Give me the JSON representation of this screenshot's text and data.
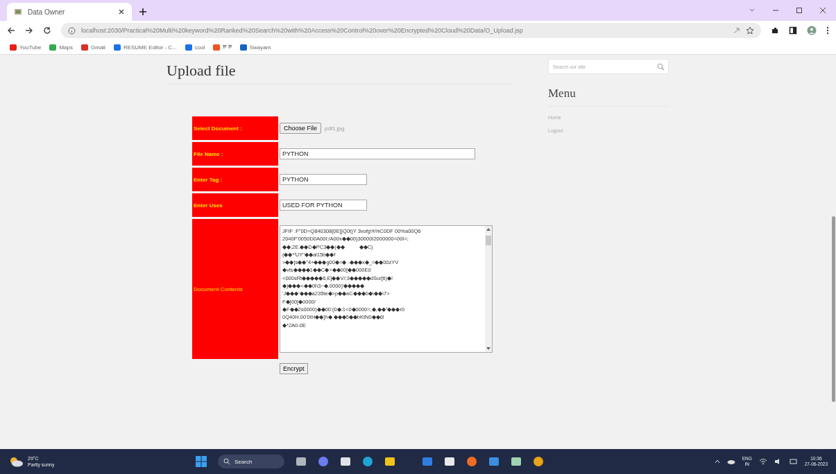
{
  "browser": {
    "tabs": [
      {
        "title": "Data Owner"
      }
    ],
    "url": "localhost:2030/Practical%20Multi%20keyword%20Ranked%20Search%20with%20Access%20Control%20over%20Encrypted%20Cloud%20Data/O_Upload.jsp",
    "bookmarks": [
      {
        "label": "YouTube",
        "color": "#e62117"
      },
      {
        "label": "Maps",
        "color": "#34a853"
      },
      {
        "label": "Gmail",
        "color": "#d93025"
      },
      {
        "label": "RESUME Editor - C...",
        "color": "#1a73e8"
      },
      {
        "label": "cool",
        "color": "#1a73e8"
      },
      {
        "label": "ਸ਼ ਸ਼",
        "color": "#f4511e"
      },
      {
        "label": "Swayam",
        "color": "#1565c0"
      }
    ]
  },
  "page": {
    "title": "Upload file",
    "form": {
      "rows": [
        {
          "kind": "file",
          "label": "Select Document :",
          "button": "Choose File",
          "value": "pdf1.jpg"
        },
        {
          "kind": "text",
          "label": "File Name :",
          "value": "PYTHON",
          "wide": true
        },
        {
          "kind": "text",
          "label": "Enter Tag :",
          "value": "PYTHON",
          "wide": false
        },
        {
          "kind": "text",
          "label": "Enter Uses",
          "value": "USED FOR PYTHON",
          "wide": false
        },
        {
          "kind": "textarea",
          "label": "Document Contents",
          "value": "JFIF :F\"0D=Q840308[0E]}Q0t}Y 3vofg%%C0DF 00%a00Q6\n2040F'0050D0A00I:/A00x◆◆00}30000I2000000=00I=;\n◆◆;2E.◆◆D◆PC3◆◆(◆◆          ◆◆C)\n(◆◆*'UY\"◆◆al15b◆◆f\n>◆◆]s◆◆\"4+◆◆◆g00◆=◆ -◆◆◆x◆_=◆◆00zYV\n◆vts◆◆◆◆1◆◆C◆=◆◆00[◆◆000E0\n<000sRt◆◆◆◆◆6,E]◆◆V/;3◆◆◆◆◆dSur[ti)◆!\n◆)◆◆◆<◆◆0h3~◆.0000)'◆◆◆◆◆\n'J◆◆◆'◆◆◆a235te◆>p◆◆aC◆◆◆0◆\\◆◆\\7>\nF◆]00[◆0000/\n◆F◆◆2s0000)◆◆00:(0◆:1<0◆0000=,◆,◆◆\"◆◆◆r0\n0Q40H.00'0tH◆◆]h◆ ◆◆◆5◆◆bKtN0◆◆6!\n◆*2A0-0E"
        }
      ],
      "submit": "Encrypt"
    },
    "sidebar": {
      "search_placeholder": "Search our site",
      "heading": "Menu",
      "links": [
        "Home",
        "Logout"
      ]
    }
  },
  "taskbar": {
    "weather_temp": "29°C",
    "weather_text": "Partly sunny",
    "search": "Search",
    "lang": "ENG",
    "region": "IN",
    "time": "10:36",
    "date": "27-06-2023"
  }
}
